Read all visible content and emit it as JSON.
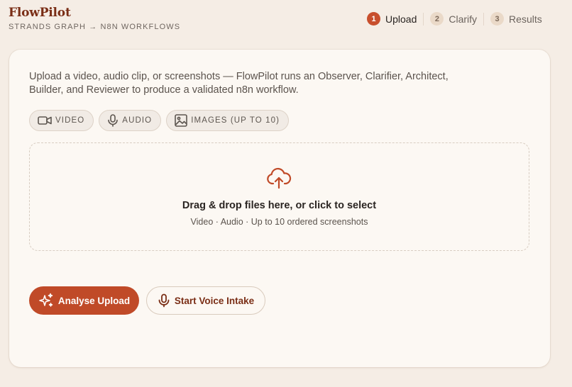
{
  "brand": {
    "title": "FlowPilot",
    "subtitle": "STRANDS GRAPH → N8N WORKFLOWS"
  },
  "steps": [
    {
      "number": "1",
      "label": "Upload",
      "active": true
    },
    {
      "number": "2",
      "label": "Clarify",
      "active": false
    },
    {
      "number": "3",
      "label": "Results",
      "active": false
    }
  ],
  "intro": "Upload a video, audio clip, or screenshots — FlowPilot runs an Observer, Clarifier, Architect, Builder, and Reviewer to produce a validated n8n workflow.",
  "media_types": [
    {
      "icon": "video-icon",
      "label": "VIDEO"
    },
    {
      "icon": "microphone-icon",
      "label": "AUDIO"
    },
    {
      "icon": "image-icon",
      "label": "IMAGES (UP TO 10)"
    }
  ],
  "dropzone": {
    "icon": "cloud-upload-icon",
    "title": "Drag & drop files here, or click to select",
    "subtitle": "Video · Audio · Up to 10 ordered screenshots"
  },
  "actions": {
    "analyse_label": "Analyse Upload",
    "analyse_icon": "sparkles-icon",
    "voice_label": "Start Voice Intake",
    "voice_icon": "microphone-icon"
  },
  "colors": {
    "accent": "#c04a28",
    "brand": "#7a2e16",
    "background": "#f5ede5",
    "card": "#fcf8f3"
  }
}
